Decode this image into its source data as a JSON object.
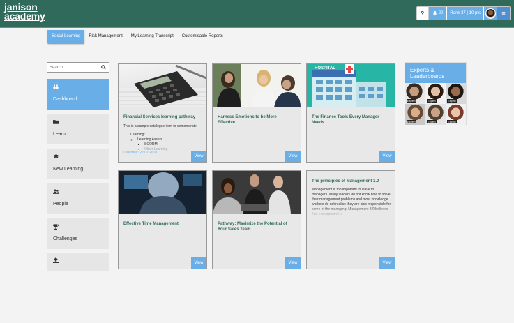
{
  "logo": {
    "line1": "janison",
    "line2": "academy"
  },
  "topbar": {
    "help": "?",
    "notification_count": "20",
    "rank": "Rank 37 | 10 pts",
    "menu": "≡"
  },
  "subnav": [
    "Social Learning",
    "Risk Management",
    "My Learning Transcript",
    "Customisable Reports"
  ],
  "search": {
    "placeholder": "Search..."
  },
  "sidebar": [
    {
      "label": "Dashboard",
      "icon": "binoculars-icon"
    },
    {
      "label": "Learn",
      "icon": "folder-icon"
    },
    {
      "label": "New Learning",
      "icon": "graduation-cap-icon"
    },
    {
      "label": "People",
      "icon": "users-icon"
    },
    {
      "label": "Challenges",
      "icon": "trophy-icon"
    },
    {
      "label": "",
      "icon": "upload-icon"
    }
  ],
  "cards": [
    {
      "title": "Financial Services learning pathway",
      "intro": "This is a sample catalogue item to demonstrate:",
      "list1": "Learning:",
      "list2": "Learning Assets",
      "list3": "SCORM",
      "list4": "Other Learning",
      "due": "Due date: 22/02/2018",
      "view": "View"
    },
    {
      "title": "Harness Emotions to be More Effective",
      "view": "View"
    },
    {
      "title": "The Finance Tools Every Manager Needs",
      "view": "View",
      "img_text": "HOSPITAL"
    },
    {
      "title": "Effective Time Management",
      "view": "View"
    },
    {
      "title": "Pathway: Maximize the Potential of Your Sales Team",
      "view": "View"
    },
    {
      "title": "The principles of Management 3.0",
      "body": "Management is too important to leave to managers. Many leaders do not know how to solve their management problems and most knowledge workers do not realise they are also responsible for some of the managing. Management 3.0 believes that management is",
      "view": "View"
    }
  ],
  "experts": {
    "title": "Experts & Leaderboards",
    "tags": [
      "Expert",
      "Expert",
      "Expert",
      "Expert",
      "Expert",
      "Expert"
    ]
  },
  "colors": {
    "header": "#2f6a5a",
    "accent": "#6aaee8"
  }
}
